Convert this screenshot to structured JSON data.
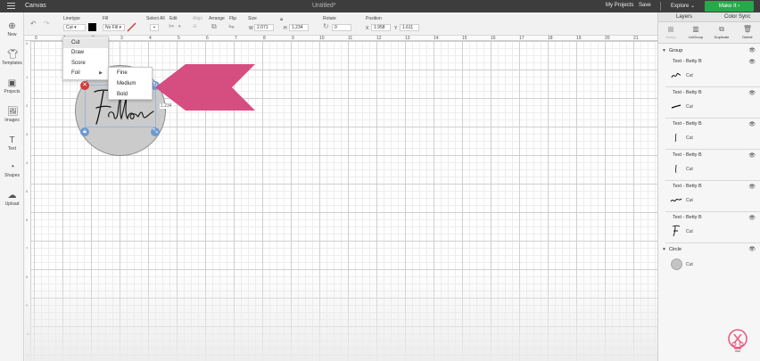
{
  "topbar": {
    "app_title": "Canvas",
    "doc_title": "Untitled*",
    "my_projects": "My Projects",
    "save": "Save",
    "explore": "Explore",
    "make_it": "Make It"
  },
  "toolbar": {
    "linetype_label": "Linetype",
    "linetype_value": "Cut",
    "fill_label": "Fill",
    "fill_value": "No Fill",
    "select_all_label": "Select All",
    "edit_label": "Edit",
    "align_label": "Align",
    "arrange_label": "Arrange",
    "flip_label": "Flip",
    "size_label": "Size",
    "size_w_label": "W",
    "size_w": "2.071",
    "size_h_label": "H",
    "size_h": "1.234",
    "rotate_label": "Rotate",
    "rotate_value": "0",
    "position_label": "Position",
    "pos_x_label": "X",
    "pos_x": "1.958",
    "pos_y_label": "Y",
    "pos_y": "1.611",
    "pen_color": "#000000",
    "accent_color": "#d23b3b"
  },
  "sidebar": {
    "items": [
      {
        "label": "New",
        "icon": "plus-circle-icon"
      },
      {
        "label": "Templates",
        "icon": "shirt-icon"
      },
      {
        "label": "Projects",
        "icon": "projects-icon"
      },
      {
        "label": "Images",
        "icon": "image-icon"
      },
      {
        "label": "Text",
        "icon": "text-icon"
      },
      {
        "label": "Shapes",
        "icon": "shapes-icon"
      },
      {
        "label": "Upload",
        "icon": "upload-icon"
      }
    ]
  },
  "ruler": {
    "top": [
      "0",
      "1",
      "2",
      "3",
      "4",
      "5",
      "6",
      "7",
      "8",
      "9",
      "10",
      "11",
      "12",
      "13",
      "14",
      "15",
      "16",
      "17",
      "18",
      "19",
      "20",
      "21"
    ],
    "left": [
      "0",
      "1",
      "2",
      "3",
      "4",
      "5",
      "6",
      "7",
      "8",
      "9",
      "10",
      "11"
    ]
  },
  "canvas": {
    "design_text": "Fallon",
    "size_readout": "1.234",
    "circle_color": "#cbcbcb",
    "arrow_color": "#d64d80"
  },
  "linetype_menu": {
    "items": [
      "Cut",
      "Draw",
      "Score",
      "Foil"
    ],
    "highlighted": "Cut"
  },
  "foil_menu": {
    "items": [
      "Fine",
      "Medium",
      "Bold"
    ]
  },
  "layers_panel": {
    "tabs": [
      "Layers",
      "Color Sync"
    ],
    "actions": [
      "Group",
      "UnGroup",
      "Duplicate",
      "Delete"
    ],
    "group_name": "Group",
    "rows": [
      {
        "name": "Text - Betty B",
        "type": "Cut"
      },
      {
        "name": "Text - Betty B",
        "type": "Cut"
      },
      {
        "name": "Text - Betty B",
        "type": "Cut"
      },
      {
        "name": "Text - Betty B",
        "type": "Cut"
      },
      {
        "name": "Text - Betty B",
        "type": "Cut"
      },
      {
        "name": "Text - Betty B",
        "type": "Cut"
      }
    ],
    "circle_name": "Circle",
    "circle_type": "Cut"
  }
}
